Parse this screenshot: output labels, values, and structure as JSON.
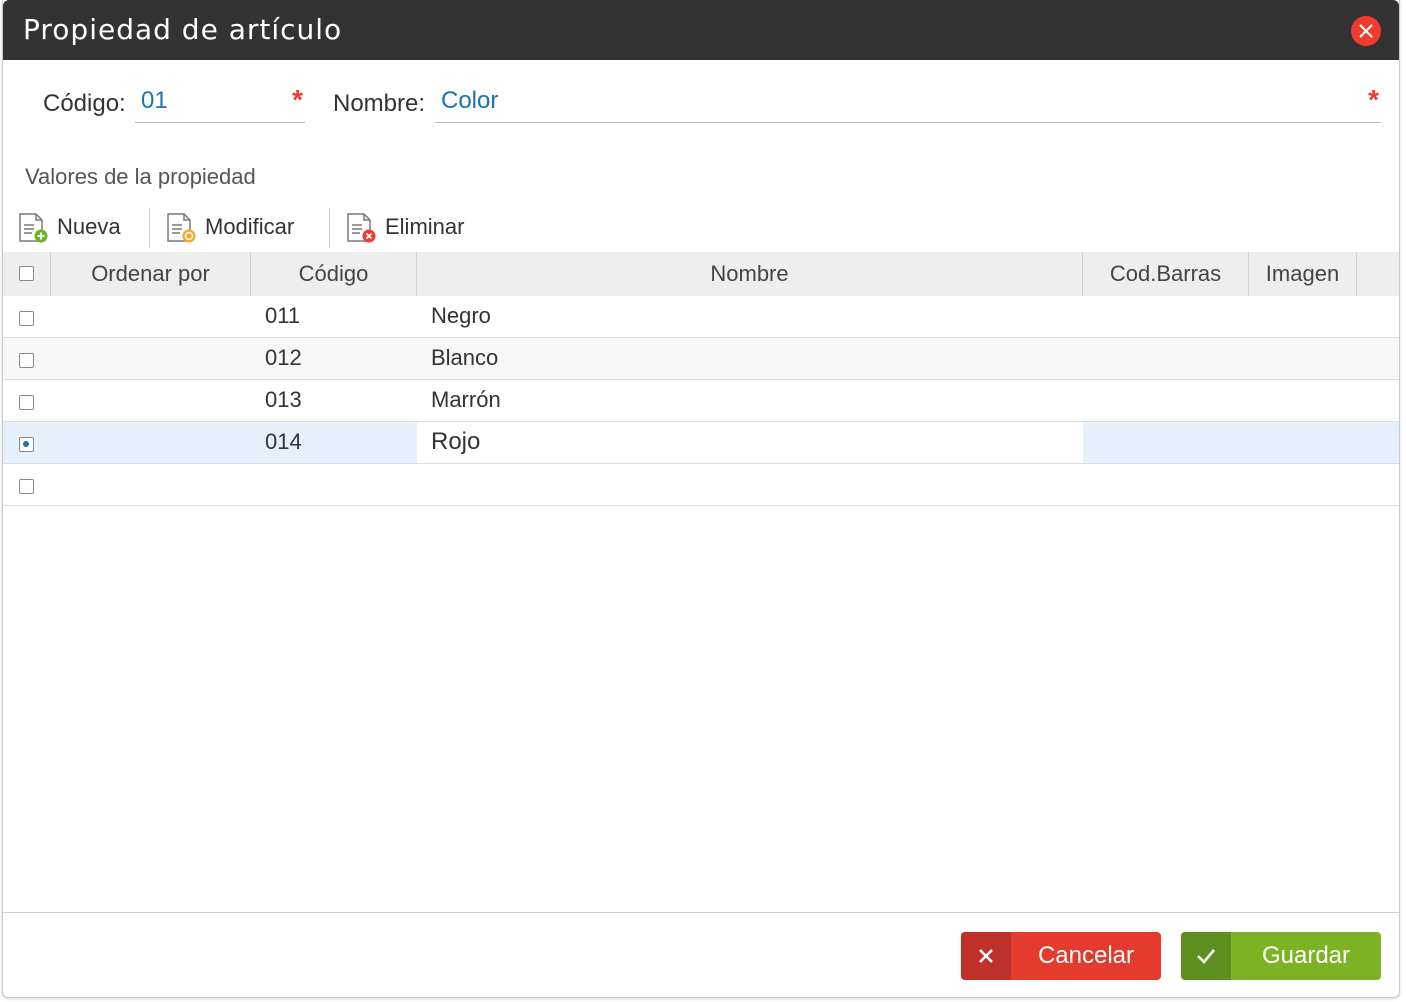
{
  "window": {
    "title": "Propiedad de artículo"
  },
  "form": {
    "codigo_label": "Código:",
    "codigo_value": "01",
    "nombre_label": "Nombre:",
    "nombre_value": "Color",
    "required_mark": "*"
  },
  "section": {
    "title": "Valores de la propiedad"
  },
  "toolbar": {
    "nueva_label": "Nueva",
    "modificar_label": "Modificar",
    "eliminar_label": "Eliminar"
  },
  "grid": {
    "columns": [
      "Ordenar por",
      "Código",
      "Nombre",
      "Cod.Barras",
      "Imagen"
    ],
    "rows": [
      {
        "ordenar": "",
        "codigo": "011",
        "nombre": "Negro",
        "cod_barras": "",
        "imagen": "",
        "checked": false
      },
      {
        "ordenar": "",
        "codigo": "012",
        "nombre": "Blanco",
        "cod_barras": "",
        "imagen": "",
        "checked": false
      },
      {
        "ordenar": "",
        "codigo": "013",
        "nombre": "Marrón",
        "cod_barras": "",
        "imagen": "",
        "checked": false
      },
      {
        "ordenar": "",
        "codigo": "014",
        "nombre": "Rojo",
        "cod_barras": "",
        "imagen": "",
        "checked": true
      },
      {
        "ordenar": "",
        "codigo": "",
        "nombre": "",
        "cod_barras": "",
        "imagen": "",
        "checked": false
      }
    ]
  },
  "footer": {
    "cancel_label": "Cancelar",
    "save_label": "Guardar"
  },
  "colors": {
    "titlebar": "#333333",
    "close": "#f13b2f",
    "accent_text": "#1a73b5",
    "cancel": "#e53a2e",
    "save": "#7cb223",
    "selected_row": "#e6f0fa"
  },
  "icons": {
    "close": "close-icon",
    "nueva": "document-add-icon",
    "modificar": "document-edit-icon",
    "eliminar": "document-delete-icon",
    "cancel": "x-icon",
    "save": "check-icon"
  }
}
